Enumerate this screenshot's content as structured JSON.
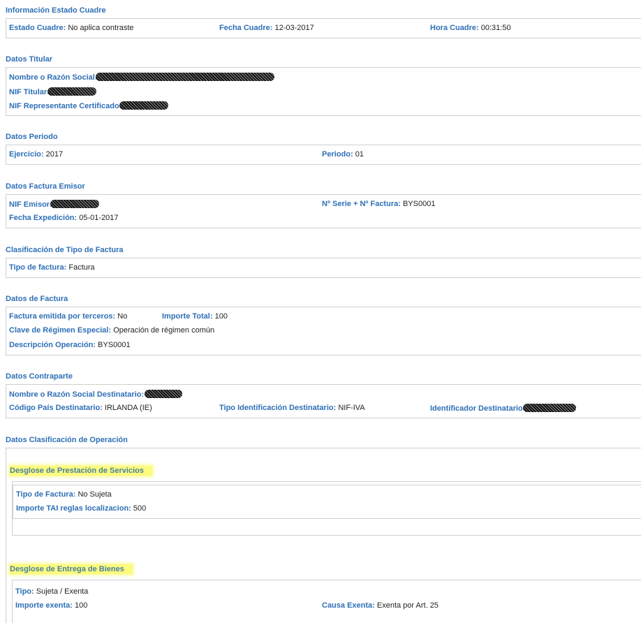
{
  "estado_cuadre": {
    "title": "Información Estado Cuadre",
    "estado_label": "Estado Cuadre:",
    "estado_value": "No aplica contraste",
    "fecha_label": "Fecha Cuadre:",
    "fecha_value": "12-03-2017",
    "hora_label": "Hora Cuadre:",
    "hora_value": "00:31:50"
  },
  "titular": {
    "title": "Datos Titular",
    "nombre_label": "Nombre o Razón Social:",
    "nif_label": "NIF Titular:",
    "nif_rep_label": "NIF Representante Certificado:"
  },
  "periodo": {
    "title": "Datos Periodo",
    "ejercicio_label": "Ejercicio:",
    "ejercicio_value": "2017",
    "periodo_label": "Periodo:",
    "periodo_value": "01"
  },
  "factura_emisor": {
    "title": "Datos Factura Emisor",
    "nif_label": "NIF Emisor:",
    "serie_label": "Nº Serie + Nº Factura:",
    "serie_value": "BYS0001",
    "fecha_label": "Fecha Expedición:",
    "fecha_value": "05-01-2017"
  },
  "clasificacion": {
    "title": "Clasificación de Tipo de Factura",
    "tipo_label": "Tipo de factura:",
    "tipo_value": "Factura"
  },
  "datos_factura": {
    "title": "Datos de Factura",
    "terceros_label": "Factura emitida por terceros:",
    "terceros_value": "No",
    "importe_label": "Importe Total:",
    "importe_value": "100",
    "clave_label": "Clave de Régimen Especial:",
    "clave_value": "Operación de régimen común",
    "desc_label": "Descripción Operación:",
    "desc_value": "BYS0001"
  },
  "contraparte": {
    "title": "Datos Contraparte",
    "nombre_label": "Nombre o Razón Social Destinatario:",
    "pais_label": "Código País Destinatario:",
    "pais_value": "IRLANDA (IE)",
    "tipo_id_label": "Tipo Identificación Destinatario:",
    "tipo_id_value": "NIF-IVA",
    "identificador_label": "Identificador Destinatario:"
  },
  "operacion": {
    "title": "Datos Clasificación de Operación",
    "servicios": {
      "title": "Desglose de Prestación de Servicios",
      "tipo_label": "Tipo de Factura:",
      "tipo_value": "No Sujeta",
      "importe_label": "Importe TAI reglas localizacion:",
      "importe_value": "500"
    },
    "bienes": {
      "title": "Desglose de Entrega de Bienes",
      "tipo_label": "Tipo:",
      "tipo_value": "Sujeta / Exenta",
      "importe_label": "Importe exenta:",
      "importe_value": "100",
      "causa_label": "Causa Exenta:",
      "causa_value": "Exenta por Art. 25"
    }
  },
  "colors": {
    "label_blue": "#2e6fb6",
    "highlight_yellow": "#fbfb7d",
    "border": "#cfcfcf"
  }
}
